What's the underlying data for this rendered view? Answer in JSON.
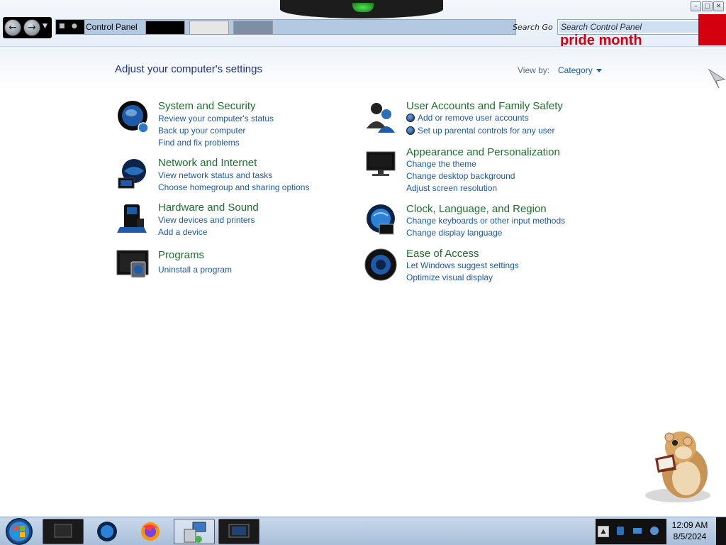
{
  "window": {
    "address": "Control Panel",
    "address_search_ghost": "Search Go",
    "search_placeholder": "Search Control Panel",
    "banner_text": "pride month"
  },
  "content": {
    "title": "Adjust your computer's settings",
    "view_by_label": "View by:",
    "view_by_value": "Category"
  },
  "categories": [
    {
      "title": "System and Security",
      "links": [
        "Review your computer's status",
        "Back up your computer",
        "Find and fix problems"
      ],
      "icon": "shield-globe-icon"
    },
    {
      "title": "Network and Internet",
      "links": [
        "View network status and tasks",
        "Choose homegroup and sharing options"
      ],
      "icon": "network-globe-icon"
    },
    {
      "title": "Hardware and Sound",
      "links": [
        "View devices and printers",
        "Add a device"
      ],
      "icon": "printer-speaker-icon"
    },
    {
      "title": "Programs",
      "links": [
        "Uninstall a program"
      ],
      "icon": "programs-icon"
    },
    {
      "title": "User Accounts and Family Safety",
      "links": [
        "Add or remove user accounts",
        "Set up parental controls for any user"
      ],
      "icon": "users-icon"
    },
    {
      "title": "Appearance and Personalization",
      "links": [
        "Change the theme",
        "Change desktop background",
        "Adjust screen resolution"
      ],
      "icon": "monitor-icon"
    },
    {
      "title": "Clock, Language, and Region",
      "links": [
        "Change keyboards or other input methods",
        "Change display language"
      ],
      "icon": "clock-globe-icon"
    },
    {
      "title": "Ease of Access",
      "links": [
        "Let Windows suggest settings",
        "Optimize visual display"
      ],
      "icon": "ease-of-access-icon"
    }
  ],
  "taskbar": {
    "time": "12:09 AM",
    "date": "8/5/2024",
    "apps": [
      "monitor-app-icon",
      "globe-app-icon",
      "firefox-icon",
      "network-app-icon",
      "screen-app-icon"
    ]
  },
  "colors": {
    "category_title": "#1e6f2e",
    "link": "#1e5aa8",
    "page_title": "#1e3287",
    "banner_red": "#d40010"
  }
}
